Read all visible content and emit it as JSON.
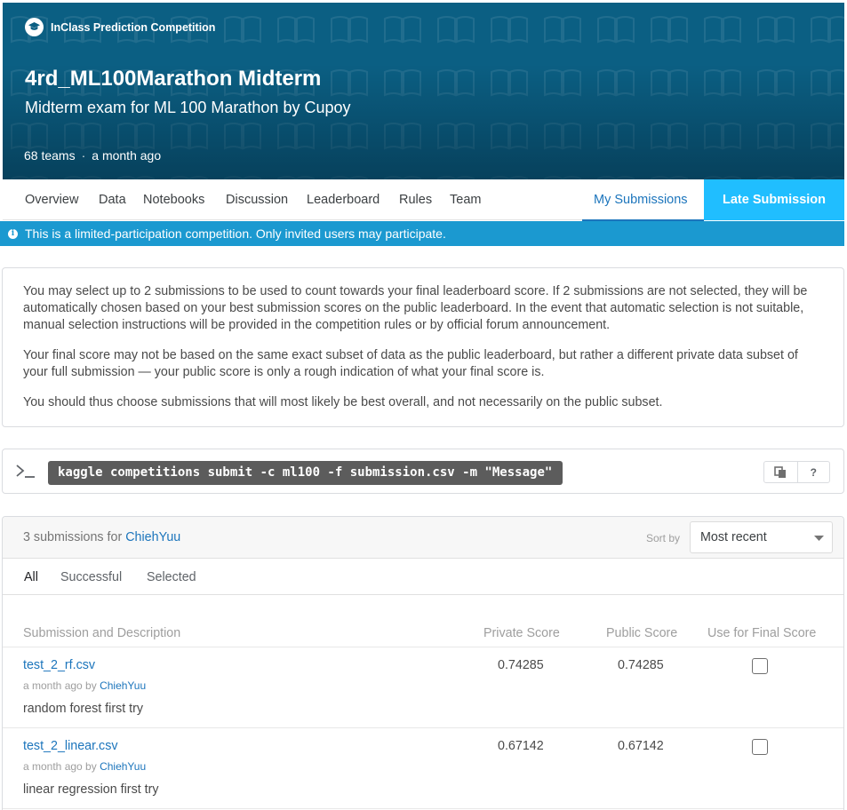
{
  "header": {
    "badge": "InClass Prediction Competition",
    "title": "4rd_ML100Marathon Midterm",
    "subtitle": "Midterm exam for ML 100 Marathon by Cupoy",
    "teams": "68 teams",
    "separator": "·",
    "time": "a month ago",
    "colors": {
      "banner": "#0b5f83",
      "accent": "#20beff"
    }
  },
  "tabs": {
    "overview": "Overview",
    "data": "Data",
    "notebooks": "Notebooks",
    "discussion": "Discussion",
    "leaderboard": "Leaderboard",
    "rules": "Rules",
    "team": "Team",
    "my_submissions": "My Submissions",
    "late_submission": "Late Submission"
  },
  "alert": {
    "icon": "info-icon",
    "text": "This is a limited-participation competition. Only invited users may participate."
  },
  "info": {
    "p1": "You may select up to 2 submissions to be used to count towards your final leaderboard score. If 2 submissions are not selected, they will be automatically chosen based on your best submission scores on the public leaderboard. In the event that automatic selection is not suitable, manual selection instructions will be provided in the competition rules or by official forum announcement.",
    "p2": "Your final score may not be based on the same exact subset of data as the public leaderboard, but rather a different private data subset of your full submission — your public score is only a rough indication of what your final score is.",
    "p3": "You should thus choose submissions that will most likely be best overall, and not necessarily on the public subset."
  },
  "cli": {
    "command": "kaggle competitions submit -c ml100 -f submission.csv -m \"Message\"",
    "help": "?"
  },
  "submissions": {
    "count_text": "3 submissions for",
    "user": "ChiehYuu",
    "sort_label": "Sort by",
    "sort_value": "Most recent",
    "filters": {
      "all": "All",
      "successful": "Successful",
      "selected": "Selected"
    },
    "columns": {
      "description": "Submission and Description",
      "private": "Private Score",
      "public": "Public Score",
      "final": "Use for Final Score"
    },
    "rows": [
      {
        "file": "test_2_rf.csv",
        "time": "a month ago by",
        "user": "ChiehYuu",
        "description": "random forest first try",
        "private": "0.74285",
        "public": "0.74285"
      },
      {
        "file": "test_2_linear.csv",
        "time": "a month ago by",
        "user": "ChiehYuu",
        "description": "linear regression first try",
        "private": "0.67142",
        "public": "0.67142"
      }
    ]
  }
}
